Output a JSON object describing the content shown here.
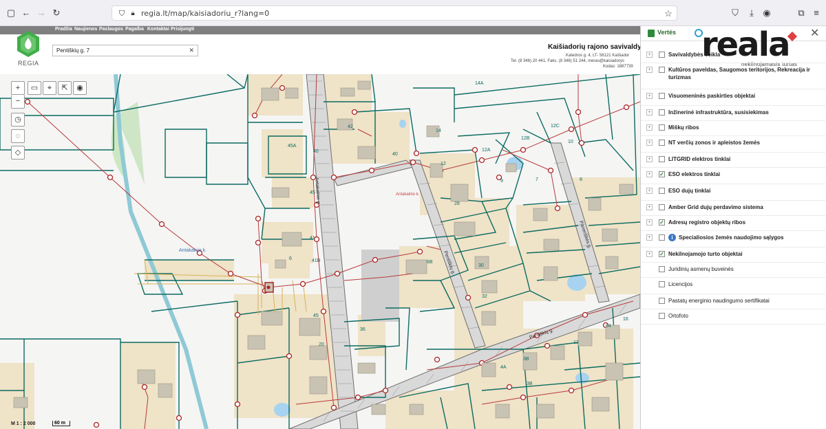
{
  "browser": {
    "url": "regia.lt/map/kaisiadoriu_r?lang=0"
  },
  "header": {
    "nav": [
      "Pradžia",
      "Naujienos",
      "Paslaugos",
      "Pagalba",
      "Kontaktai",
      "Prisijungti"
    ],
    "logo_text": "REGIA",
    "search_value": "Pentiškių g. 7",
    "muni_title": "Kaišiadorių rajono savivaldyb",
    "muni_address": "Katedros g. 4, LT- 56121 Kaišiador",
    "muni_phone": "Tel. (8 346) 20 441, Faks. (8 346) 51 244, meras@kaisiadorys",
    "muni_code": "Kodas: 1887739"
  },
  "map": {
    "scale_label": "M 1 : 2 000",
    "scale_bar": "60 m",
    "place_label": "Antakalnio k.",
    "parcel_labels": [
      "14A",
      "12A",
      "12B",
      "12C",
      "14",
      "12",
      "10",
      "9",
      "7",
      "8",
      "45A",
      "40",
      "42",
      "45",
      "41",
      "41B",
      "6B",
      "6",
      "3B",
      "20",
      "28",
      "30",
      "32",
      "34",
      "36",
      "45",
      "4A",
      "3B",
      "12",
      "16",
      "40"
    ],
    "street_labels": [
      "Antakalnio g.",
      "Pentiškių g.",
      "Paneriškės g."
    ],
    "place_colors": {
      "parcel": "#0b6b60",
      "building": "#c9c3b4",
      "lot_fill": "#efe3c8",
      "road": "#7a7a7a",
      "power": "#b73a3a",
      "green": "#cde8c2",
      "water": "#a7d3f0"
    }
  },
  "panel": {
    "tab_label": "Vertės",
    "brand": "reala",
    "brand_sub": "nekilnojamasis turtas",
    "layers": [
      {
        "label": "Savivaldybės veikla",
        "checked": false,
        "expand": true,
        "bold": true
      },
      {
        "label": "Kultūros paveldas, Saugomos teritorijos, Rekreacija ir turizmas",
        "checked": false,
        "expand": true,
        "bold": true
      },
      {
        "label": "Visuomeninės paskirties objektai",
        "checked": false,
        "expand": true,
        "bold": true
      },
      {
        "label": "Inžinerinė infrastruktūra, susisiekimas",
        "checked": false,
        "expand": true,
        "bold": true
      },
      {
        "label": "Miškų ribos",
        "checked": false,
        "expand": true,
        "bold": true
      },
      {
        "label": "NT verčių zonos ir apleistos žemės",
        "checked": false,
        "expand": true,
        "bold": true
      },
      {
        "label": "LITGRID elektros tinklai",
        "checked": false,
        "expand": true,
        "bold": true
      },
      {
        "label": "ESO elektros tinklai",
        "checked": true,
        "expand": true,
        "bold": true
      },
      {
        "label": "ESO dujų tinklai",
        "checked": false,
        "expand": true,
        "bold": true
      },
      {
        "label": "Amber Grid dujų perdavimo sistema",
        "checked": false,
        "expand": true,
        "bold": true
      },
      {
        "label": "Adresų registro objektų ribos",
        "checked": true,
        "expand": true,
        "bold": true
      },
      {
        "label": "Specialiosios žemės naudojimo sąlygos",
        "checked": false,
        "expand": true,
        "bold": true,
        "info": true
      },
      {
        "label": "Nekilnojamojo turto objektai",
        "checked": true,
        "expand": true,
        "bold": true
      },
      {
        "label": "Juridinių asmenų buveinės",
        "checked": false,
        "expand": false,
        "bold": false
      },
      {
        "label": "Licencijos",
        "checked": false,
        "expand": false,
        "bold": false
      },
      {
        "label": "Pastatų energinio naudingumo sertifikatai",
        "checked": false,
        "expand": false,
        "bold": false
      },
      {
        "label": "Ortofoto",
        "checked": false,
        "expand": false,
        "bold": false
      }
    ]
  }
}
